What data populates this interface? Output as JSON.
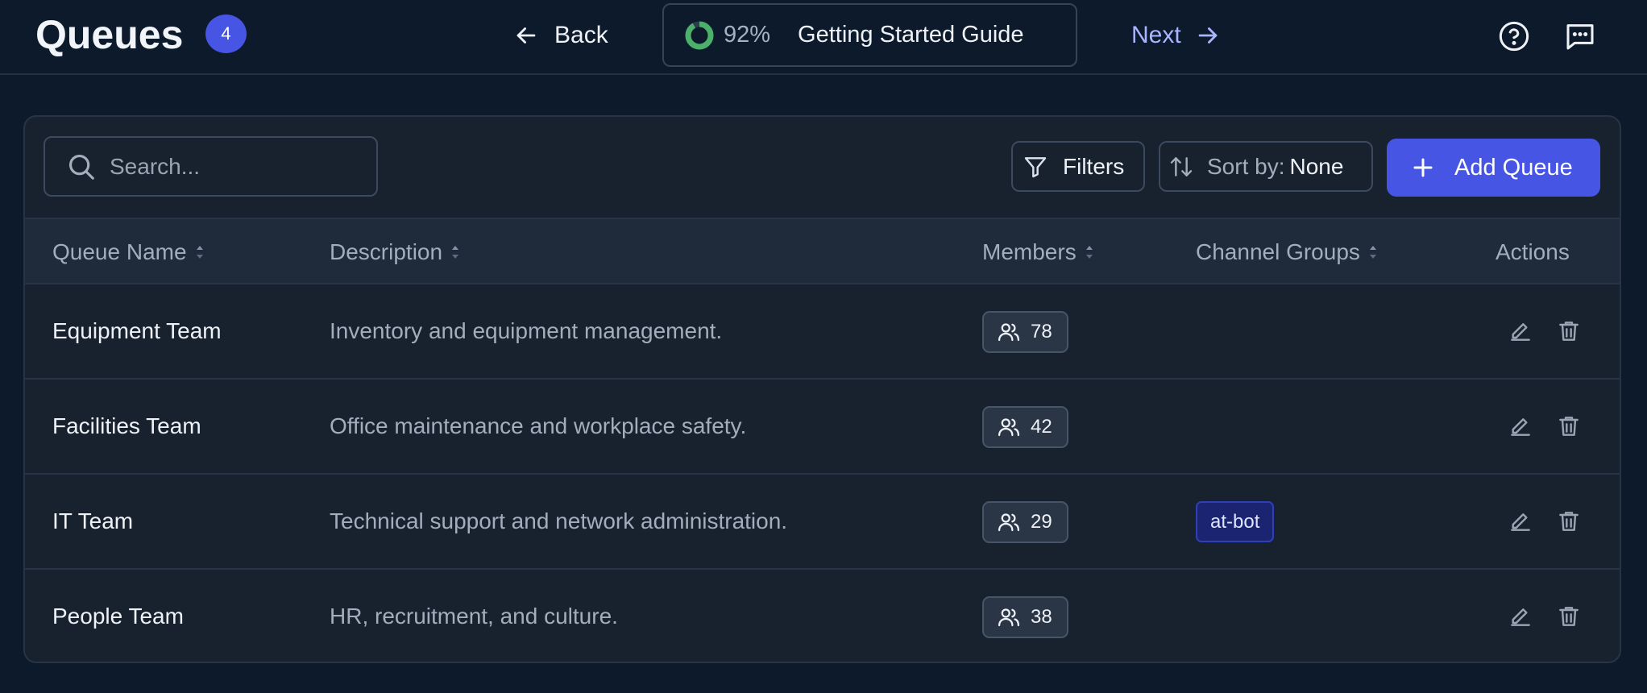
{
  "header": {
    "title": "Queues",
    "queue_count": "4",
    "back_label": "Back",
    "guide": {
      "progress_percent": 92,
      "progress_label": "92%",
      "title": "Getting Started Guide"
    },
    "next_label": "Next"
  },
  "toolbar": {
    "search_placeholder": "Search...",
    "filters_label": "Filters",
    "sort_prefix": "Sort by:",
    "sort_value": "None",
    "add_label": "Add Queue"
  },
  "table": {
    "columns": {
      "name": "Queue Name",
      "description": "Description",
      "members": "Members",
      "channel_groups": "Channel Groups",
      "actions": "Actions"
    },
    "rows": [
      {
        "name": "Equipment Team",
        "description": "Inventory and equipment management.",
        "members": "78",
        "channel_group": ""
      },
      {
        "name": "Facilities Team",
        "description": "Office maintenance and workplace safety.",
        "members": "42",
        "channel_group": ""
      },
      {
        "name": "IT Team",
        "description": "Technical support and network administration.",
        "members": "29",
        "channel_group": "at-bot"
      },
      {
        "name": "People Team",
        "description": "HR, recruitment, and culture.",
        "members": "38",
        "channel_group": ""
      }
    ]
  },
  "colors": {
    "background": "#0d1a2b",
    "panel": "#18222f",
    "accent": "#4655e4",
    "progress": "#4caf6a",
    "next_link": "#aab5ff"
  },
  "icons": {
    "back": "arrow-left-icon",
    "next": "arrow-right-icon",
    "help": "help-circle-icon",
    "chat": "chat-icon",
    "search": "search-icon",
    "filter": "filter-icon",
    "sort": "sort-icon",
    "add": "plus-icon",
    "members": "users-icon",
    "edit": "pencil-icon",
    "delete": "trash-icon"
  }
}
